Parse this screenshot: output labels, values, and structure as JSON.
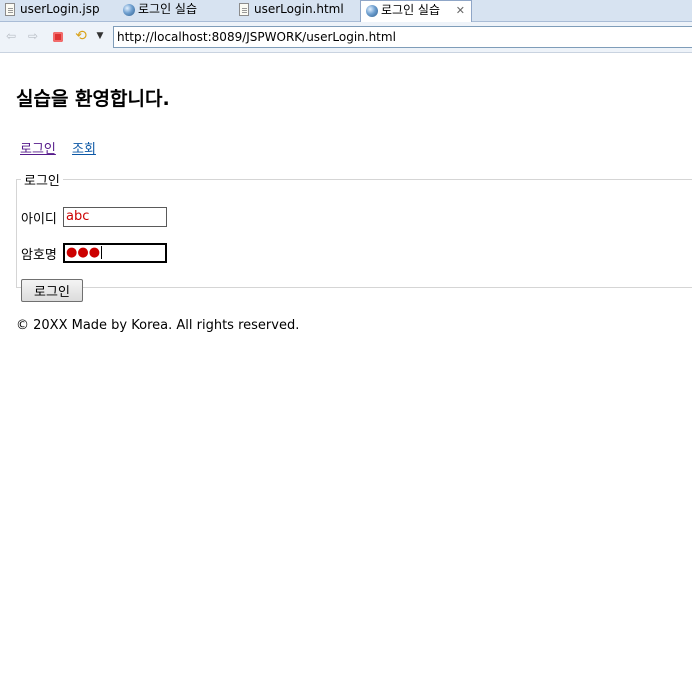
{
  "tabs": [
    {
      "label": "userLogin.jsp",
      "icon": "document-icon"
    },
    {
      "label": "로그인 실습",
      "icon": "globe-icon"
    },
    {
      "label": "userLogin.html",
      "icon": "document-icon"
    },
    {
      "label": "로그인 실습",
      "icon": "globe-icon",
      "close": "✕"
    }
  ],
  "toolbar": {
    "back": "⇦",
    "forward": "⇨",
    "refresh": "⟲",
    "dropdown": "▼",
    "url": "http://localhost:8089/JSPWORK/userLogin.html"
  },
  "page": {
    "heading": "실습을 환영합니다.",
    "links": [
      "로그인",
      "조회"
    ],
    "form": {
      "legend": "로그인",
      "id_label": "아이디",
      "id_value": "abc",
      "pw_label": "암호명",
      "pw_mask": "●●●",
      "submit_label": "로그인"
    },
    "footer": "© 20XX Made by Korea. All rights reserved."
  },
  "colors": {
    "visited_link": "#551a8b",
    "link": "#0b57a5",
    "input_text": "#cc0000"
  }
}
